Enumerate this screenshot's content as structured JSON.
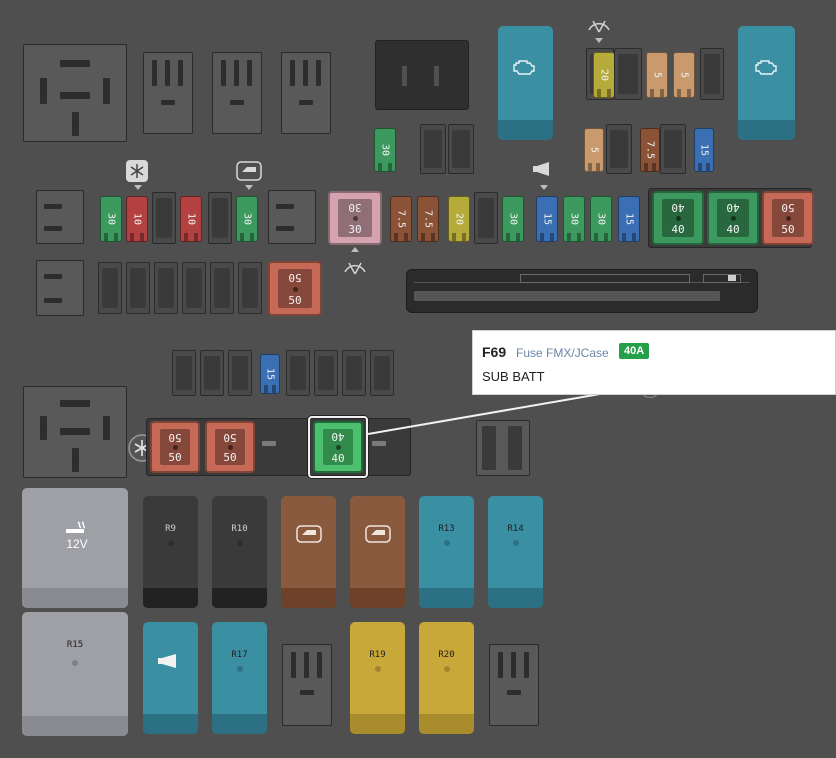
{
  "colors": {
    "green": "#3d9a5e",
    "red": "#b34141",
    "blue": "#3b6fb4",
    "brown": "#8a5236",
    "yellow": "#b5aa3a",
    "tan": "#c99a6d",
    "pink": "#d5a3b0",
    "salmon": "#c66a57",
    "teal": "#3a8fa3",
    "highlight": "#4cc06e"
  },
  "top_minis": [
    {
      "label": "20",
      "color": "yellow"
    },
    {
      "label": "5",
      "color": "tan"
    },
    {
      "label": "5",
      "color": "tan"
    }
  ],
  "upper_right_minis": [
    {
      "label": "5",
      "color": "tan"
    },
    {
      "label": "7.5",
      "color": "brown"
    },
    {
      "label": "15",
      "color": "blue"
    }
  ],
  "mini_30_top": {
    "label": "30",
    "color": "green"
  },
  "row_a_left": [
    {
      "label": "30",
      "color": "green"
    },
    {
      "label": "10",
      "color": "red"
    },
    {
      "label": "10",
      "color": "red"
    },
    {
      "label": "30",
      "color": "green"
    }
  ],
  "big_pink": {
    "top": "30",
    "bottom": "30"
  },
  "row_a_right": [
    {
      "label": "7.5",
      "color": "brown"
    },
    {
      "label": "7.5",
      "color": "brown"
    },
    {
      "label": "20",
      "color": "yellow"
    },
    {
      "label": "30",
      "color": "green"
    },
    {
      "label": "15",
      "color": "blue"
    },
    {
      "label": "30",
      "color": "green"
    },
    {
      "label": "30",
      "color": "green"
    },
    {
      "label": "15",
      "color": "blue"
    }
  ],
  "row_a_maxis": [
    {
      "top": "40",
      "bottom": "40",
      "color": "green"
    },
    {
      "top": "40",
      "bottom": "40",
      "color": "green"
    },
    {
      "top": "50",
      "bottom": "50",
      "color": "salmon"
    }
  ],
  "row_b_maxi": {
    "top": "50",
    "bottom": "50"
  },
  "lower_mini": {
    "label": "15",
    "color": "blue"
  },
  "lower_maxis": [
    {
      "top": "50",
      "bottom": "50"
    },
    {
      "top": "50",
      "bottom": "50"
    }
  ],
  "selected_fuse": {
    "top": "40",
    "bottom": "40"
  },
  "relays": {
    "r_12v": "12V",
    "r9": "R9",
    "r10": "R10",
    "r13": "R13",
    "r14": "R14",
    "r15": "R15",
    "r17": "R17",
    "r19": "R19",
    "r20": "R20"
  },
  "callout": {
    "code": "F69",
    "kind": "Fuse FMX/JCase",
    "amperage": "40A",
    "description": "SUB BATT"
  }
}
